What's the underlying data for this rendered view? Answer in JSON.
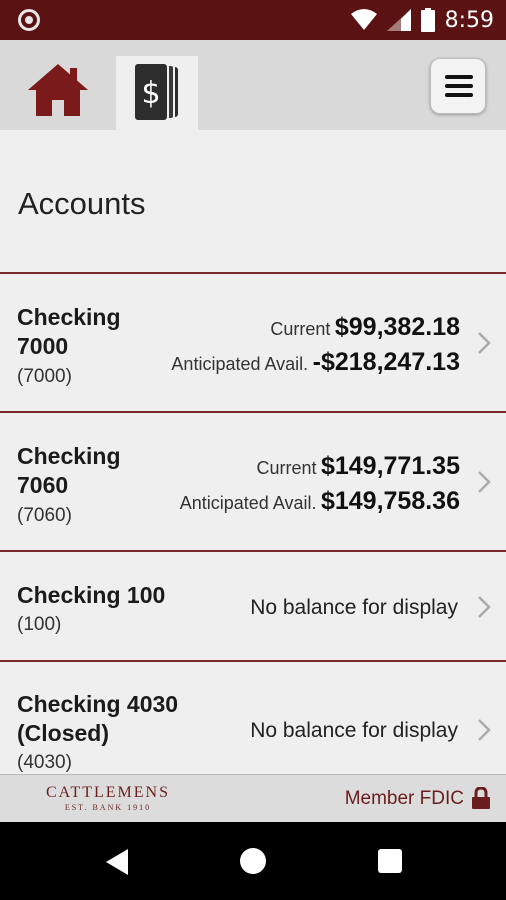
{
  "status_bar": {
    "time": "8:59",
    "left_icon": "record-icon",
    "icons": [
      "wifi-icon",
      "signal-icon",
      "battery-icon"
    ]
  },
  "top_nav": {
    "home_icon": "home-icon",
    "accounts_icon": "dollar-cards-icon",
    "menu_icon": "hamburger-menu-icon"
  },
  "page": {
    "title": "Accounts"
  },
  "accounts": [
    {
      "name_line1": "Checking",
      "name_line2": "7000",
      "number": "(7000)",
      "current_label": "Current",
      "current_value": "$99,382.18",
      "avail_label": "Anticipated Avail.",
      "avail_value": "-$218,247.13"
    },
    {
      "name_line1": "Checking",
      "name_line2": "7060",
      "number": "(7060)",
      "current_label": "Current",
      "current_value": "$149,771.35",
      "avail_label": "Anticipated Avail.",
      "avail_value": "$149,758.36"
    },
    {
      "name_line1": "Checking 100",
      "number": "(100)",
      "no_balance": "No balance for display"
    },
    {
      "name_line1": "Checking 4030",
      "name_line2": "(Closed)",
      "number": "(4030)",
      "no_balance": "No balance for display"
    }
  ],
  "footer": {
    "logo_name": "CATTLEMENS",
    "logo_sub": "EST. BANK 1910",
    "fdic": "Member FDIC",
    "lock_icon": "lock-icon"
  },
  "colors": {
    "brand": "#5b1212",
    "accent": "#7a2a2a"
  }
}
